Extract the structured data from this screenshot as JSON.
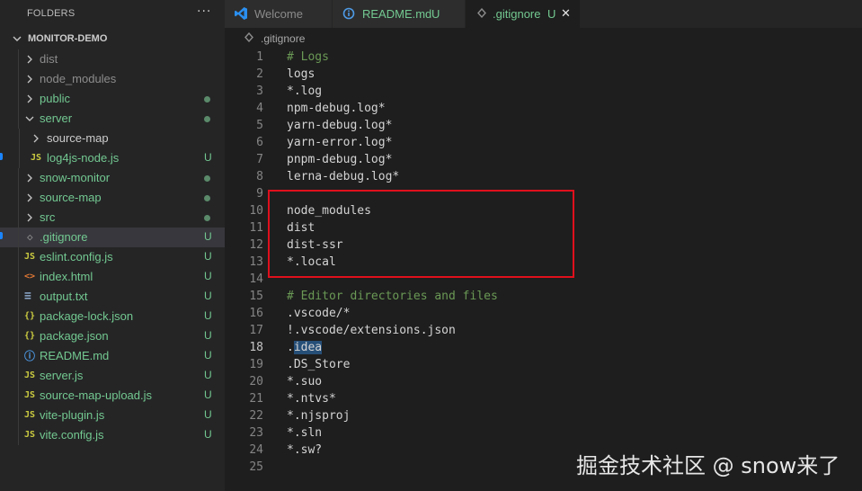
{
  "sidebar": {
    "title": "FOLDERS",
    "more": "···",
    "root": "MONITOR-DEMO",
    "items": [
      {
        "label": "dist",
        "kind": "folder",
        "color": "#8c8c8c",
        "status": ""
      },
      {
        "label": "node_modules",
        "kind": "folder",
        "color": "#8c8c8c",
        "status": ""
      },
      {
        "label": "public",
        "kind": "folder",
        "color": "#73c991",
        "status": "dot"
      },
      {
        "label": "server",
        "kind": "folder-open",
        "color": "#73c991",
        "status": "dot"
      },
      {
        "label": "source-map",
        "kind": "folder-nested",
        "color": "#cccccc",
        "status": ""
      },
      {
        "label": "log4js-node.js",
        "kind": "js-nested",
        "color": "#73c991",
        "status": "U"
      },
      {
        "label": "snow-monitor",
        "kind": "folder",
        "color": "#73c991",
        "status": "dot"
      },
      {
        "label": "source-map",
        "kind": "folder",
        "color": "#73c991",
        "status": "dot"
      },
      {
        "label": "src",
        "kind": "folder",
        "color": "#73c991",
        "status": "dot"
      },
      {
        "label": ".gitignore",
        "kind": "gitignore",
        "color": "#73c991",
        "status": "U",
        "selected": true
      },
      {
        "label": "eslint.config.js",
        "kind": "js",
        "color": "#73c991",
        "status": "U"
      },
      {
        "label": "index.html",
        "kind": "html",
        "color": "#73c991",
        "status": "U"
      },
      {
        "label": "output.txt",
        "kind": "txt",
        "color": "#73c991",
        "status": "U"
      },
      {
        "label": "package-lock.json",
        "kind": "json",
        "color": "#73c991",
        "status": "U"
      },
      {
        "label": "package.json",
        "kind": "json",
        "color": "#73c991",
        "status": "U"
      },
      {
        "label": "README.md",
        "kind": "md",
        "color": "#73c991",
        "status": "U"
      },
      {
        "label": "server.js",
        "kind": "js",
        "color": "#73c991",
        "status": "U"
      },
      {
        "label": "source-map-upload.js",
        "kind": "js",
        "color": "#73c991",
        "status": "U"
      },
      {
        "label": "vite-plugin.js",
        "kind": "js",
        "color": "#73c991",
        "status": "U"
      },
      {
        "label": "vite.config.js",
        "kind": "js",
        "color": "#73c991",
        "status": "U"
      }
    ]
  },
  "tabs": [
    {
      "label": "Welcome",
      "badge": "",
      "icon": "vscode-icon",
      "active": false
    },
    {
      "label": "README.md",
      "badge": "U",
      "icon": "info-icon",
      "active": false
    },
    {
      "label": ".gitignore",
      "badge": "U",
      "icon": "gitignore-icon",
      "active": true,
      "close": "✕"
    }
  ],
  "breadcrumb": {
    "file": ".gitignore"
  },
  "editor": {
    "current_line": 18,
    "lines": [
      {
        "n": "1",
        "text": "# Logs",
        "comment": true
      },
      {
        "n": "2",
        "text": "logs"
      },
      {
        "n": "3",
        "text": "*.log"
      },
      {
        "n": "4",
        "text": "npm-debug.log*"
      },
      {
        "n": "5",
        "text": "yarn-debug.log*"
      },
      {
        "n": "6",
        "text": "yarn-error.log*"
      },
      {
        "n": "7",
        "text": "pnpm-debug.log*"
      },
      {
        "n": "8",
        "text": "lerna-debug.log*"
      },
      {
        "n": "9",
        "text": ""
      },
      {
        "n": "10",
        "text": "node_modules"
      },
      {
        "n": "11",
        "text": "dist"
      },
      {
        "n": "12",
        "text": "dist-ssr"
      },
      {
        "n": "13",
        "text": "*.local"
      },
      {
        "n": "14",
        "text": ""
      },
      {
        "n": "15",
        "text": "# Editor directories and files",
        "comment": true
      },
      {
        "n": "16",
        "text": ".vscode/*"
      },
      {
        "n": "17",
        "text": "!.vscode/extensions.json"
      },
      {
        "n": "18",
        "text": ".idea"
      },
      {
        "n": "19",
        "text": ".DS_Store"
      },
      {
        "n": "20",
        "text": "*.suo"
      },
      {
        "n": "21",
        "text": "*.ntvs*"
      },
      {
        "n": "22",
        "text": "*.njsproj"
      },
      {
        "n": "23",
        "text": "*.sln"
      },
      {
        "n": "24",
        "text": "*.sw?"
      },
      {
        "n": "25",
        "text": ""
      }
    ]
  },
  "watermark": "掘金技术社区 @ snow来了",
  "colors": {
    "untracked": "#73c991",
    "highlight_box": "#e0101c",
    "comment": "#6a9955",
    "accent": "#1a85ff"
  }
}
